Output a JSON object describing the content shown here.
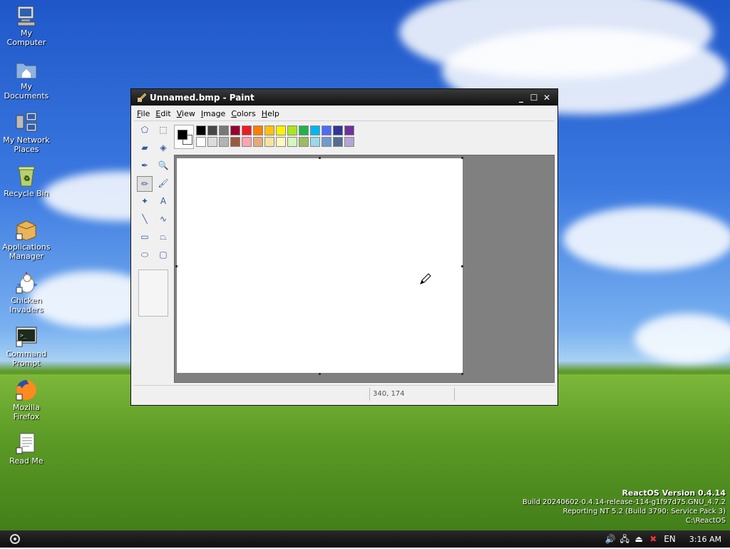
{
  "desktop": {
    "icons": [
      {
        "label": "My Computer",
        "icon": "computer-icon"
      },
      {
        "label": "My Documents",
        "icon": "folder-documents-icon"
      },
      {
        "label": "My Network Places",
        "icon": "network-icon"
      },
      {
        "label": "Recycle Bin",
        "icon": "recycle-bin-icon"
      },
      {
        "label": "Applications Manager",
        "icon": "package-icon"
      },
      {
        "label": "Chicken Invaders",
        "icon": "chicken-icon"
      },
      {
        "label": "Command Prompt",
        "icon": "terminal-icon"
      },
      {
        "label": "Mozilla Firefox",
        "icon": "firefox-icon"
      },
      {
        "label": "Read Me",
        "icon": "document-icon"
      }
    ]
  },
  "os_info": {
    "version": "ReactOS Version 0.4.14",
    "build": "Build 20240602-0.4.14-release-114-g1f97d75.GNU_4.7.2",
    "reporting": "Reporting NT 5.2 (Build 3790: Service Pack 3)",
    "path": "C:\\ReactOS"
  },
  "window": {
    "title": "Unnamed.bmp - Paint",
    "controls": {
      "minimize": "_",
      "maximize": "☐",
      "close": "✕"
    },
    "menu": [
      "File",
      "Edit",
      "View",
      "Image",
      "Colors",
      "Help"
    ],
    "status": {
      "coords": "340, 174",
      "selection_size": ""
    },
    "palette": {
      "foreground": "#000000",
      "background": "#ffffff",
      "row1": [
        "#000000",
        "#464646",
        "#787878",
        "#990030",
        "#ed1c24",
        "#ff7e00",
        "#ffc20e",
        "#fff200",
        "#a8e61d",
        "#22b14c",
        "#00b7ef",
        "#4d6df3",
        "#2f3699",
        "#6f3198"
      ],
      "row2": [
        "#ffffff",
        "#dcdcdc",
        "#b4b4b4",
        "#9c5a3c",
        "#ffa3b1",
        "#e5aa7a",
        "#f5e49c",
        "#fff9bd",
        "#d3f9bc",
        "#9dbb61",
        "#99d9ea",
        "#709ad1",
        "#546d8e",
        "#b5a5d5"
      ]
    },
    "tools": [
      {
        "name": "free-select-tool",
        "glyph": "⬠"
      },
      {
        "name": "rect-select-tool",
        "glyph": "⬚"
      },
      {
        "name": "eraser-tool",
        "glyph": "▰"
      },
      {
        "name": "fill-tool",
        "glyph": "◈"
      },
      {
        "name": "color-picker-tool",
        "glyph": "✒"
      },
      {
        "name": "magnifier-tool",
        "glyph": "🔍"
      },
      {
        "name": "pencil-tool",
        "glyph": "✏"
      },
      {
        "name": "brush-tool",
        "glyph": "🖌"
      },
      {
        "name": "airbrush-tool",
        "glyph": "✦"
      },
      {
        "name": "text-tool",
        "glyph": "A"
      },
      {
        "name": "line-tool",
        "glyph": "╲"
      },
      {
        "name": "curve-tool",
        "glyph": "∿"
      },
      {
        "name": "rectangle-tool",
        "glyph": "▭"
      },
      {
        "name": "polygon-tool",
        "glyph": "⏢"
      },
      {
        "name": "ellipse-tool",
        "glyph": "⬭"
      },
      {
        "name": "rounded-rect-tool",
        "glyph": "▢"
      }
    ],
    "selected_tool": "pencil-tool"
  },
  "taskbar": {
    "start_icon": "reactos-logo-icon",
    "tray": {
      "volume_icon": "🔊",
      "network_icon": "🖧",
      "usb_icon": "⏏",
      "network_error_icon": "✖",
      "language": "EN",
      "clock": "3:16 AM"
    }
  }
}
